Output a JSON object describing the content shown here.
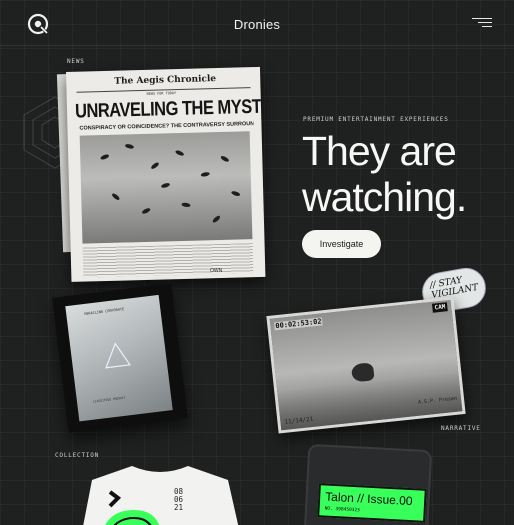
{
  "header": {
    "brand": "Dronies",
    "logo_icon": "dronies-logo-icon",
    "menu_icon": "menu-icon"
  },
  "hero": {
    "eyebrow": "PREMIUM ENTERTAINMENT EXPERIENCES",
    "title": "They are watching.",
    "cta_label": "Investigate"
  },
  "sections": {
    "news": "NEWS",
    "collection": "COLLECTION",
    "narrative": "NARRATIVE"
  },
  "newspaper": {
    "masthead": "The Aegis Chronicle",
    "issue_tag": "NEWS FOR TODAY",
    "headline": "UNRAVELING THE MYSTERY",
    "subhead": "CONSPIRACY OR COINCIDENCE? THE CONTRAVERSY SURROUNDING...",
    "tail_text": "OWN"
  },
  "card": {
    "top_text": "HERACLINE CORPORATE",
    "bottom_text": "CLASSIFIED PRODUCT"
  },
  "cctv": {
    "timecode": "00:02:53:02",
    "cam_label": "CAM",
    "date": "11/14/21",
    "signature": "A.S.P. Presen"
  },
  "sticker": {
    "text_line1": "// STAY",
    "text_line2": "VIGILANT"
  },
  "tee": {
    "date_text": "08 06 21"
  },
  "issue": {
    "title": "Talon // Issue.00",
    "number": "NO. 398450323"
  },
  "colors": {
    "background": "#1f2020",
    "accent_green": "#39ff5a",
    "cta_bg": "#f4f5f1"
  }
}
